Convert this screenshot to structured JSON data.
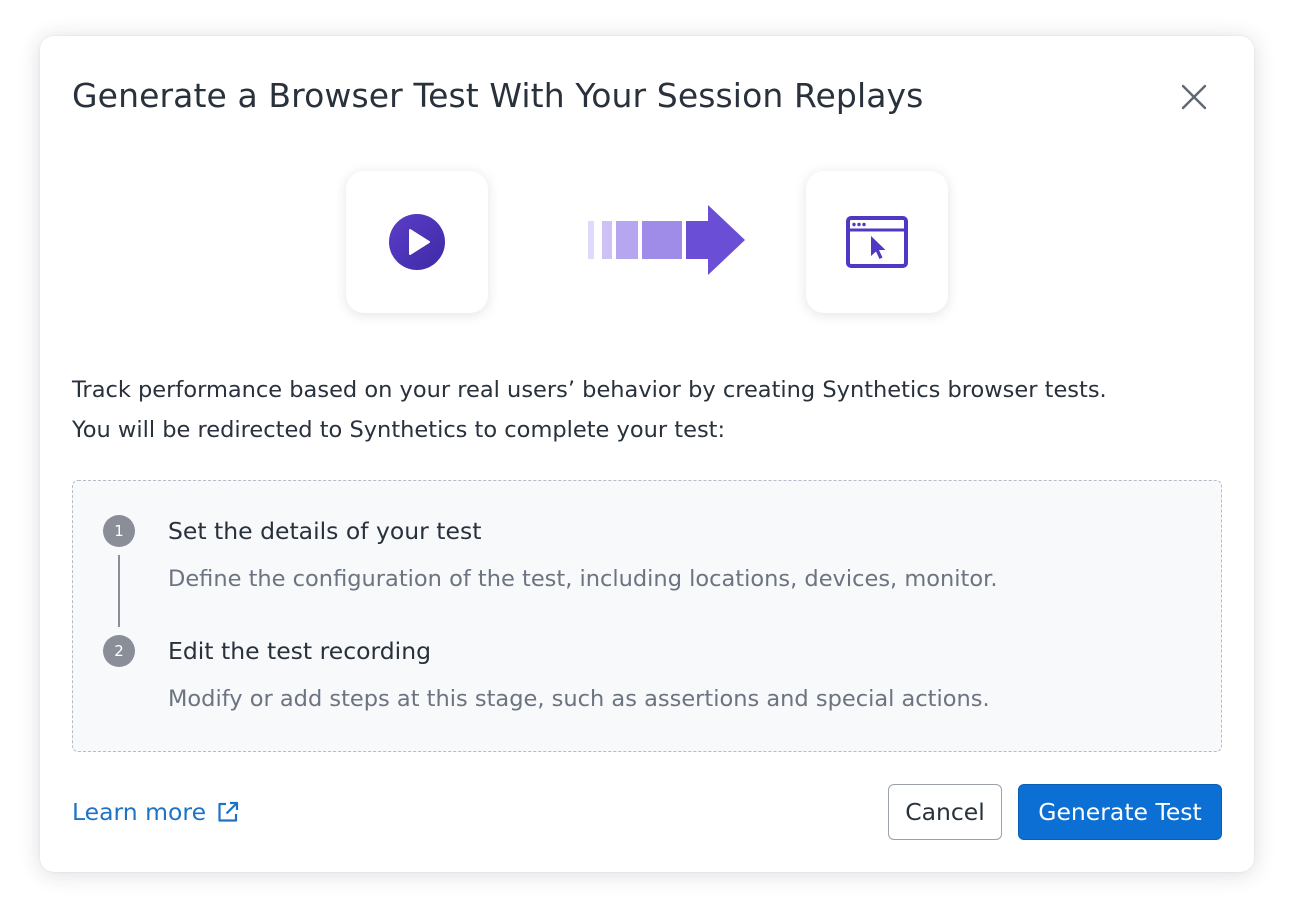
{
  "dialog": {
    "title": "Generate a Browser Test With Your Session Replays",
    "close_icon": "close-icon"
  },
  "illustration": {
    "source_icon": "play-circle-icon",
    "transition_icon": "arrow-right-icon",
    "target_icon": "browser-cursor-icon",
    "accent_color": "#6a4fd6",
    "accent_light": "#b5a6ef"
  },
  "description": {
    "line1": "Track performance based on your real users’ behavior by creating Synthetics browser tests.",
    "line2": "You will be redirected to Synthetics to complete your test:"
  },
  "steps": [
    {
      "number": "1",
      "title": "Set the details of your test",
      "description": "Define the configuration of the test, including locations, devices, monitor."
    },
    {
      "number": "2",
      "title": "Edit the test recording",
      "description": "Modify or add steps at this stage, such as assertions and special actions."
    }
  ],
  "footer": {
    "learn_more": "Learn more",
    "learn_more_icon": "external-link-icon",
    "cancel_label": "Cancel",
    "primary_label": "Generate Test",
    "primary_color": "#0b6fd3",
    "link_color": "#1f73c4"
  }
}
